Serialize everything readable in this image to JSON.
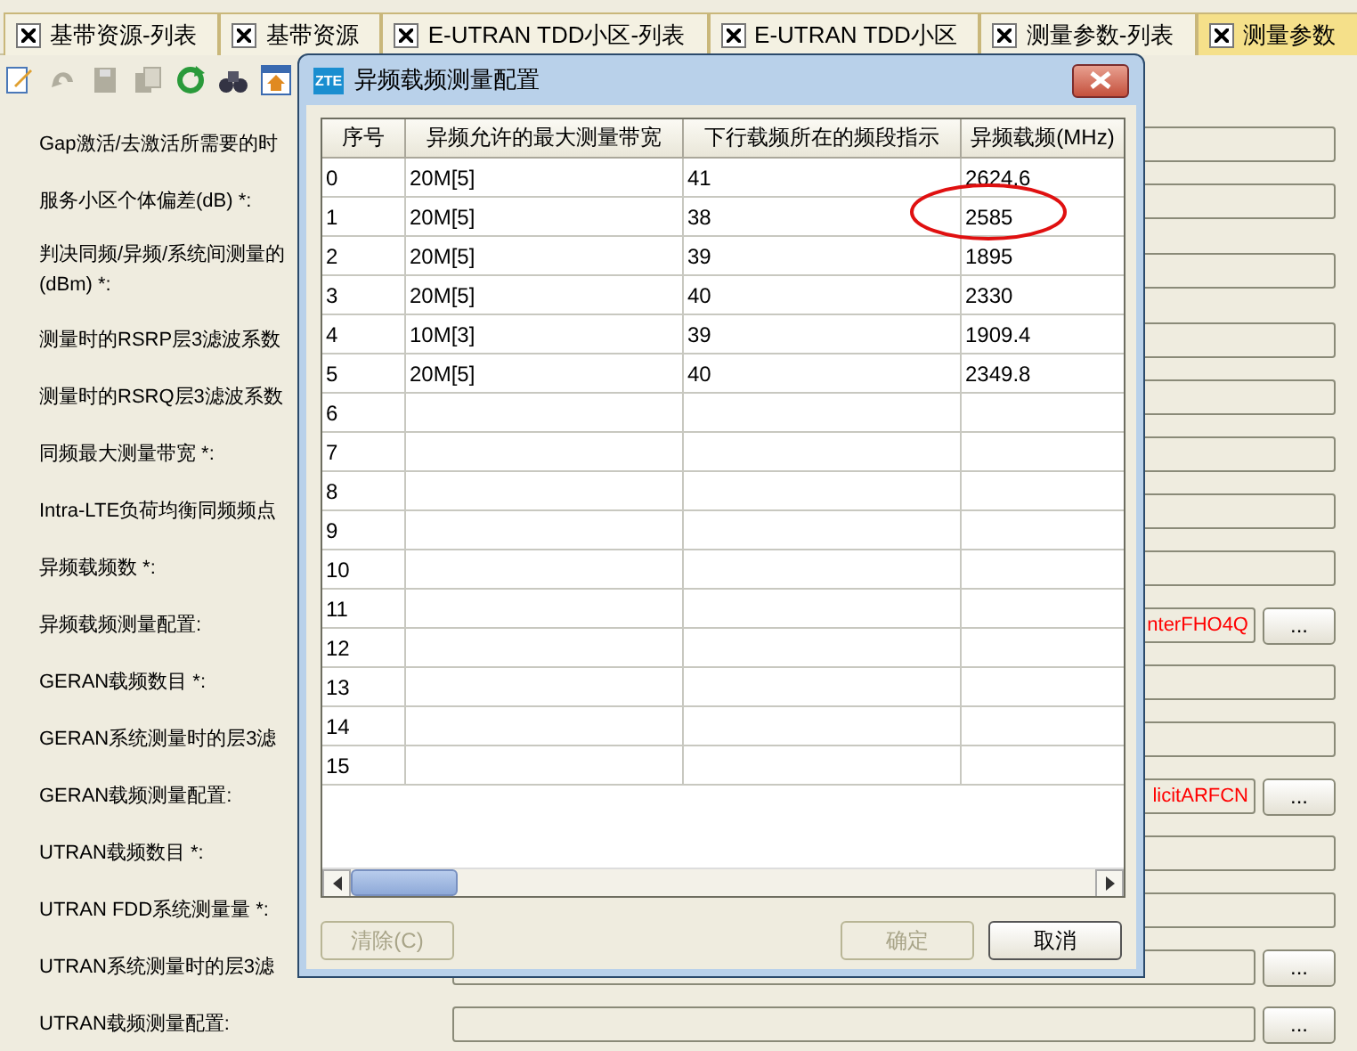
{
  "tabs": [
    {
      "label": "基带资源-列表",
      "selected": false
    },
    {
      "label": "基带资源",
      "selected": false
    },
    {
      "label": "E-UTRAN TDD小区-列表",
      "selected": false
    },
    {
      "label": "E-UTRAN TDD小区",
      "selected": false
    },
    {
      "label": "测量参数-列表",
      "selected": false
    },
    {
      "label": "测量参数",
      "selected": true
    }
  ],
  "toolbar": [
    {
      "kind": "edit",
      "disabled": false
    },
    {
      "kind": "undo",
      "disabled": true
    },
    {
      "kind": "save",
      "disabled": true
    },
    {
      "kind": "copy",
      "disabled": true
    },
    {
      "kind": "refresh",
      "disabled": false
    },
    {
      "kind": "find",
      "disabled": false
    },
    {
      "kind": "home",
      "disabled": false
    }
  ],
  "form": [
    {
      "label": "Gap激活/去激活所需要的时",
      "kind": "field"
    },
    {
      "label": "服务小区个体偏差(dB) *:",
      "kind": "field"
    },
    {
      "label": "判决同频/异频/系统间测量的",
      "label_2": "(dBm) *:",
      "kind": "field"
    },
    {
      "label": "测量时的RSRP层3滤波系数",
      "kind": "field"
    },
    {
      "label": "测量时的RSRQ层3滤波系数",
      "kind": "field"
    },
    {
      "label": "同频最大测量带宽 *:",
      "kind": "field"
    },
    {
      "label": "Intra-LTE负荷均衡同频频点",
      "kind": "field"
    },
    {
      "label": "异频载频数 *:",
      "kind": "field"
    },
    {
      "label": "异频载频测量配置:",
      "kind": "picker",
      "value": "nterFHO4Q",
      "button": "..."
    },
    {
      "label": "GERAN载频数目 *:",
      "kind": "field"
    },
    {
      "label": "GERAN系统测量时的层3滤",
      "kind": "field"
    },
    {
      "label": "GERAN载频测量配置:",
      "kind": "picker",
      "value": "licitARFCN",
      "button": "..."
    },
    {
      "label": "UTRAN载频数目 *:",
      "kind": "field"
    },
    {
      "label": "UTRAN FDD系统测量量 *:",
      "kind": "field"
    },
    {
      "label": "UTRAN系统测量时的层3滤",
      "kind": "picker",
      "button": "..."
    },
    {
      "label": "UTRAN载频测量配置:",
      "kind": "picker",
      "button": "..."
    }
  ],
  "dialog": {
    "title": "异频载频测量配置",
    "logo": "ZTE",
    "columns": [
      "序号",
      "异频允许的最大测量带宽",
      "下行载频所在的频段指示",
      "异频载频(MHz)"
    ],
    "rows": [
      [
        "0",
        "20M[5]",
        "41",
        "2624.6"
      ],
      [
        "1",
        "20M[5]",
        "38",
        "2585"
      ],
      [
        "2",
        "20M[5]",
        "39",
        "1895"
      ],
      [
        "3",
        "20M[5]",
        "40",
        "2330"
      ],
      [
        "4",
        "10M[3]",
        "39",
        "1909.4"
      ],
      [
        "5",
        "20M[5]",
        "40",
        "2349.8"
      ],
      [
        "6"
      ],
      [
        "7"
      ],
      [
        "8"
      ],
      [
        "9"
      ],
      [
        "10"
      ],
      [
        "11"
      ],
      [
        "12"
      ],
      [
        "13"
      ],
      [
        "14"
      ],
      [
        "15"
      ]
    ],
    "buttons": [
      {
        "label": "清除(C)",
        "disabled": true,
        "kind": "left"
      },
      {
        "label": "确定",
        "disabled": true,
        "kind": "right"
      },
      {
        "label": "取消",
        "disabled": false,
        "kind": "right"
      }
    ]
  }
}
